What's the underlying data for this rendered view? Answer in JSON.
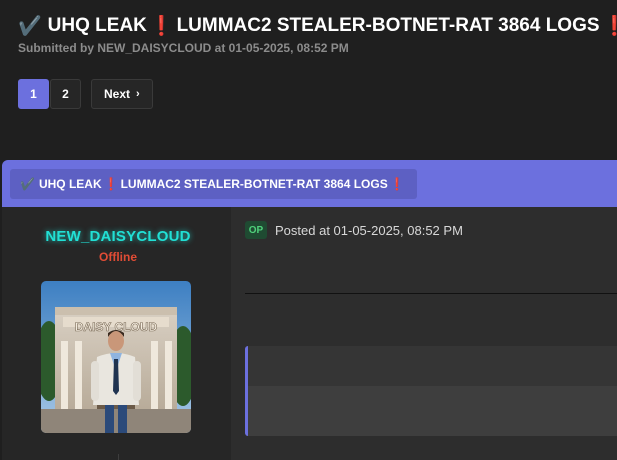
{
  "thread": {
    "check_glyph": "✔️",
    "title_part1": "UHQ LEAK",
    "exclaim": "❗",
    "title_part2": "LUMMAC2 STEALER-BOTNET-RAT 3864 LOGS",
    "submitted_by": "Submitted by NEW_DAISYCLOUD at 01-05-2025, 08:52 PM"
  },
  "pagination": {
    "pages": [
      "1",
      "2"
    ],
    "active_page": "1",
    "next_label": "Next",
    "next_icon": "›"
  },
  "post": {
    "bar_title_part1": "UHQ LEAK",
    "bar_title_part2": "LUMMAC2 STEALER-BOTNET-RAT 3864 LOGS",
    "author": {
      "username": "NEW_DAISYCLOUD",
      "status": "Offline",
      "avatar_text": "DAISY CLOUD"
    },
    "op_badge": "OP",
    "posted_at": "Posted at 01-05-2025, 08:52 PM"
  },
  "colors": {
    "accent": "#6c70de",
    "username": "#21e0d5",
    "offline": "#e04c35",
    "exclaim": "#e23a3a",
    "op_badge_bg": "#1f4b32",
    "op_badge_text": "#4fd17b"
  }
}
